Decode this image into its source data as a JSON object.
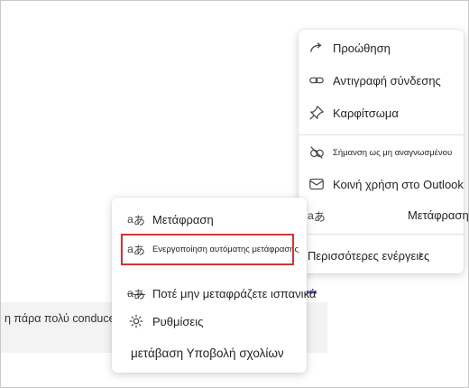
{
  "background_message": {
    "text": "η πάρα πολύ conduce σόμπα"
  },
  "main_menu": {
    "items": [
      {
        "label": "Προώθηση",
        "icon": "forward-arrow-icon"
      },
      {
        "label": "Αντιγραφή σύνδεσης",
        "icon": "link-icon"
      },
      {
        "label": "Καρφίτσωμα",
        "icon": "pin-icon"
      },
      {
        "label": "Σήμανση ως μη αναγνωσμένου",
        "icon": "eye-off-icon"
      },
      {
        "label": "Κοινή χρήση στο Outlook",
        "icon": "mail-icon"
      },
      {
        "label": "Μετάφραση",
        "icon": "translate-icon"
      },
      {
        "label": "Περισσότερες ενέργειες",
        "icon": "chevron-right-icon"
      }
    ]
  },
  "submenu": {
    "items": [
      {
        "label": "Μετάφραση",
        "icon": "translate-icon"
      },
      {
        "label": "Ενεργοποίηση αυτόματης μετάφρασης",
        "icon": "auto-translate-icon"
      },
      {
        "label": "Ποτέ μην μεταφράζετε ισπανικά",
        "icon": "translate-off-icon"
      },
      {
        "label": "Ρυθμίσεις",
        "icon": "gear-icon"
      },
      {
        "label": "μετάβαση Υποβολή σχολίων",
        "icon": ""
      }
    ]
  },
  "colors": {
    "highlight_border": "#d13438",
    "dots": "#5b5fc7"
  }
}
